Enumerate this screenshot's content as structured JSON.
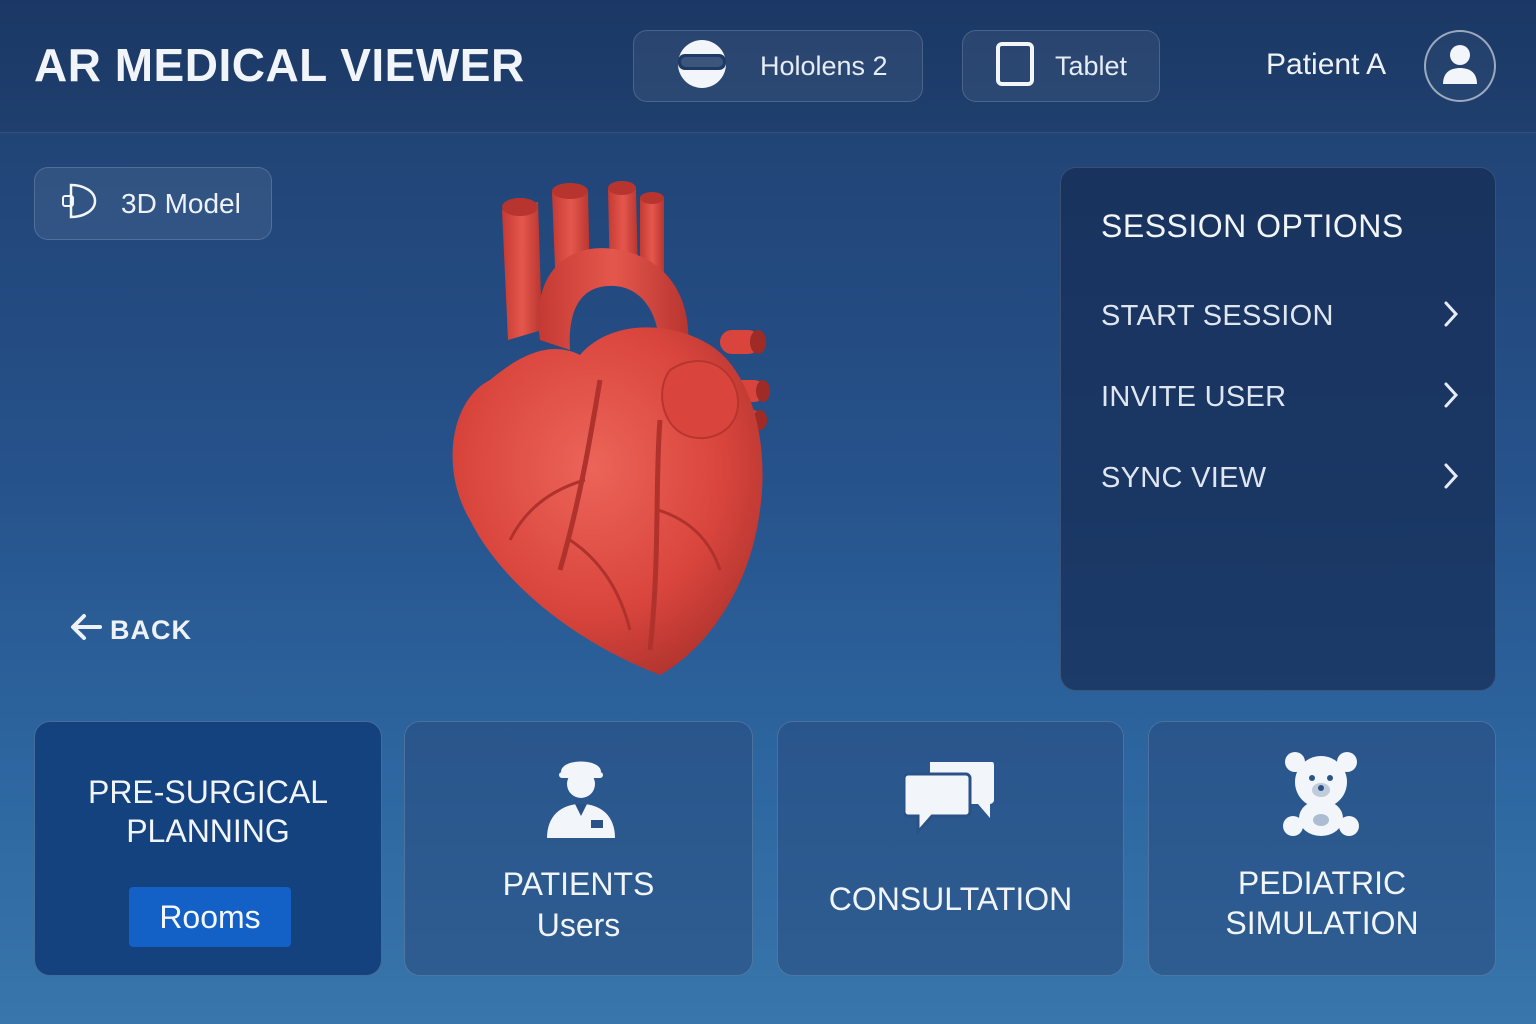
{
  "app": {
    "title": "AR MEDICAL VIEWER"
  },
  "header": {
    "devices": [
      {
        "label": "Hololens 2",
        "icon": "vr-headset-icon"
      },
      {
        "label": "Tablet",
        "icon": "tablet-icon"
      }
    ],
    "patient_name": "Patient A",
    "avatar_icon": "user-icon"
  },
  "viewer": {
    "mode_label": "3D Model",
    "mode_icon": "3d-model-icon",
    "model": "heart-model",
    "back_label": "BACK"
  },
  "session": {
    "title": "SESSION OPTIONS",
    "items": [
      {
        "label": "START SESSION"
      },
      {
        "label": "INVITE USER"
      },
      {
        "label": "SYNC VIEW"
      }
    ]
  },
  "tiles": {
    "presurgical": {
      "line1": "PRE-SURGICAL",
      "line2": "PLANNING",
      "button": "Rooms"
    },
    "patients": {
      "line1": "PATIENTS",
      "line2": "Users",
      "icon": "doctor-icon"
    },
    "consultation": {
      "label": "CONSULTATION",
      "icon": "chat-bubbles-icon"
    },
    "pediatric": {
      "line1": "PEDIATRIC",
      "line2": "SIMULATION",
      "icon": "teddy-bear-icon"
    }
  },
  "colors": {
    "background": "#26518a",
    "topbar": "#1b3865",
    "accent": "#1360c7",
    "heart": "#d9453d"
  }
}
